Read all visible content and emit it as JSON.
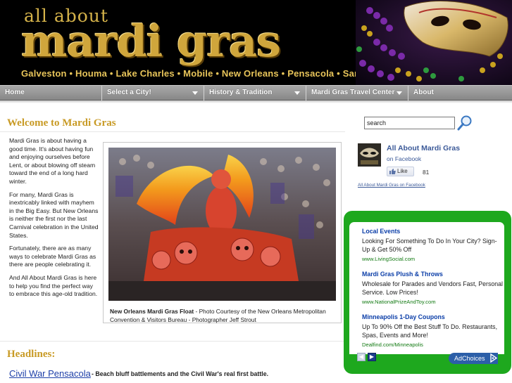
{
  "header": {
    "tagline": "all about",
    "logo": "mardi gras",
    "cities": "Galveston • Houma • Lake Charles • Mobile • New Orleans • Pensacola • San Diego • St. Louis"
  },
  "nav": {
    "items": [
      {
        "label": "Home"
      },
      {
        "label": "Select a City!"
      },
      {
        "label": "History & Tradition"
      },
      {
        "label": "Mardi Gras Travel Center"
      },
      {
        "label": "About"
      }
    ]
  },
  "main": {
    "title": "Welcome to Mardi Gras",
    "paragraphs": [
      "Mardi Gras is about having a good time. It's about having fun and enjoying ourselves before Lent, or about blowing off steam toward the end of a long hard winter.",
      "For many, Mardi Gras is inextricably linked with mayhem in the Big Easy. But New Orleans is neither the first nor the last Carnival celebration in the United States.",
      "Fortunately, there are as many ways to celebrate Mardi Gras as there are people celebrating it.",
      "And All About Mardi Gras is here to help you find the perfect way to embrace this age-old tradition."
    ],
    "photo_caption_bold": "New Orleans Mardi Gras Float",
    "photo_caption_rest": " - Photo Courtesy of the New Orleans Metropolitan Convention & Visitors Bureau - Photographer Jeff Strout",
    "headlines_title": "Headlines:",
    "headline": {
      "link": "Civil War Pensacola",
      "desc": "- Beach bluff battlements and the Civil War's real first battle."
    }
  },
  "sidebar": {
    "search": {
      "value": "search"
    },
    "facebook": {
      "name": "All About Mardi Gras",
      "sub": "on Facebook",
      "like_label": "Like",
      "like_count": "81",
      "link": "All About Mardi Gras on Facebook"
    },
    "ads": [
      {
        "title": "Local Events",
        "text": "Looking For Something To Do In Your City? Sign-Up & Get 50% Off",
        "url": "www.LivingSocial.com"
      },
      {
        "title": "Mardi Gras Plush & Throws",
        "text": "Wholesale for Parades and Vendors Fast, Personal Service. Low Prices!",
        "url": "www.NationalPrizeAndToy.com"
      },
      {
        "title": "Minneapolis 1-Day Coupons",
        "text": "Up To 90% Off the Best Stuff To Do. Restaurants, Spas, Events and More!",
        "url": "Dealfind.com/Minneapolis"
      }
    ],
    "adchoices": "AdChoices"
  },
  "colors": {
    "gold": "#c89a24",
    "link_blue": "#1d3fa8",
    "ad_green": "#1ea81e",
    "facebook_blue": "#3b5998"
  }
}
